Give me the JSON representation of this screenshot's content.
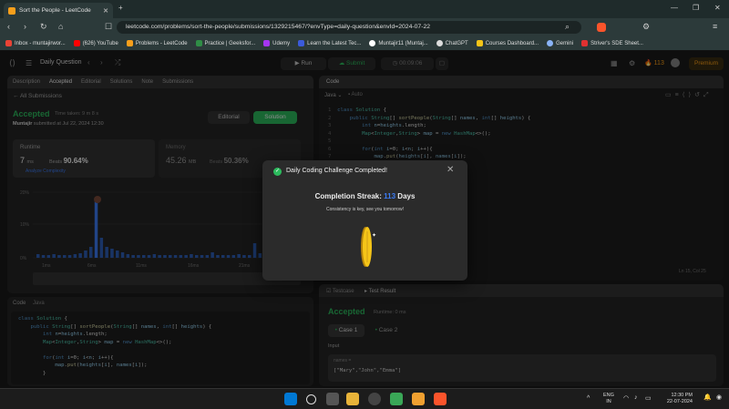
{
  "browser": {
    "tab_title": "Sort the People - LeetCode",
    "url": "leetcode.com/problems/sort-the-people/submissions/1329215467/?envType=daily-question&envId=2024-07-22",
    "bookmarks": [
      {
        "label": "Inbox - muntajirwor...",
        "color": "#ea4335"
      },
      {
        "label": "(626) YouTube",
        "color": "#ff0000"
      },
      {
        "label": "Problems - LeetCode",
        "color": "#f89f1b"
      },
      {
        "label": "Practice | Geeksfor...",
        "color": "#2f8d46"
      },
      {
        "label": "Udemy",
        "color": "#a435f0"
      },
      {
        "label": "Learn the Latest Tec...",
        "color": "#3b5bdb"
      },
      {
        "label": "Muntajir11 (Muntaj...",
        "color": "#ffffff"
      },
      {
        "label": "ChatGPT",
        "color": "#dddddd"
      },
      {
        "label": "Courses Dashboard...",
        "color": "#f5c518"
      },
      {
        "label": "Gemini",
        "color": "#8ab4f8"
      },
      {
        "label": "Striver's SDE Sheet...",
        "color": "#e03131"
      }
    ]
  },
  "header": {
    "problem_list": "Daily Question",
    "run": "Run",
    "submit": "Submit",
    "timer": "00:09:06",
    "streak": "113",
    "premium": "Premium"
  },
  "left": {
    "tabs": [
      "Description",
      "Accepted",
      "Editorial",
      "Solutions",
      "Note",
      "Submissions"
    ],
    "all_submissions": "All Submissions",
    "status": "Accepted",
    "time_taken": "Time taken: 9 m 8 s",
    "user": "Muntajir",
    "submitted_on": "submitted at Jul 22, 2024 12:30",
    "editorial_btn": "Editorial",
    "solution_btn": "Solution",
    "runtime_label": "Runtime",
    "runtime_value": "7",
    "runtime_unit": "ms",
    "runtime_beats_label": "Beats",
    "runtime_beats": "90.64%",
    "analyze": "Analyze Complexity",
    "memory_label": "Memory",
    "memory_value": "45.26",
    "memory_unit": "MB",
    "memory_beats_label": "Beats",
    "memory_beats": "50.36%",
    "chart_y": [
      "20%",
      "10%",
      "0%"
    ],
    "chart_x": [
      "1ms",
      "6ms",
      "11ms",
      "16ms",
      "21ms",
      "26ms"
    ],
    "code_label": "Code",
    "code_lang": "Java"
  },
  "code_lines": [
    "class Solution {",
    "    public String[] sortPeople(String[] names, int[] heights) {",
    "        int n=heights.length;",
    "        Map<Integer,String> map = new HashMap<>();",
    "",
    "        for(int i=0; i<n; i++){",
    "            map.put(heights[i], names[i]);",
    "        }"
  ],
  "right": {
    "code_tab": "Code",
    "lang": "Java",
    "auto": "Auto",
    "cursor_pos": "Ln 15, Col 25",
    "testcase_tab": "Testcase",
    "result_tab": "Test Result",
    "result_status": "Accepted",
    "result_runtime": "Runtime: 0 ms",
    "case1": "Case 1",
    "case2": "Case 2",
    "input_label": "Input",
    "input_var": "names =",
    "input_value": "[\"Mary\",\"John\",\"Emma\"]"
  },
  "modal": {
    "title": "Daily Coding Challenge Completed!",
    "streak_label": "Completion Streak:",
    "streak_value": "113",
    "streak_unit": "Days",
    "subtitle": "Consistency is key, see you tomorrow!"
  },
  "taskbar": {
    "lang1": "ENG",
    "lang2": "IN",
    "time": "12:30 PM",
    "date": "22-07-2024"
  },
  "colors": {
    "accent_green": "#2cbb5d",
    "accent_blue": "#3c7cf6",
    "leetcode_orange": "#ffa116"
  }
}
